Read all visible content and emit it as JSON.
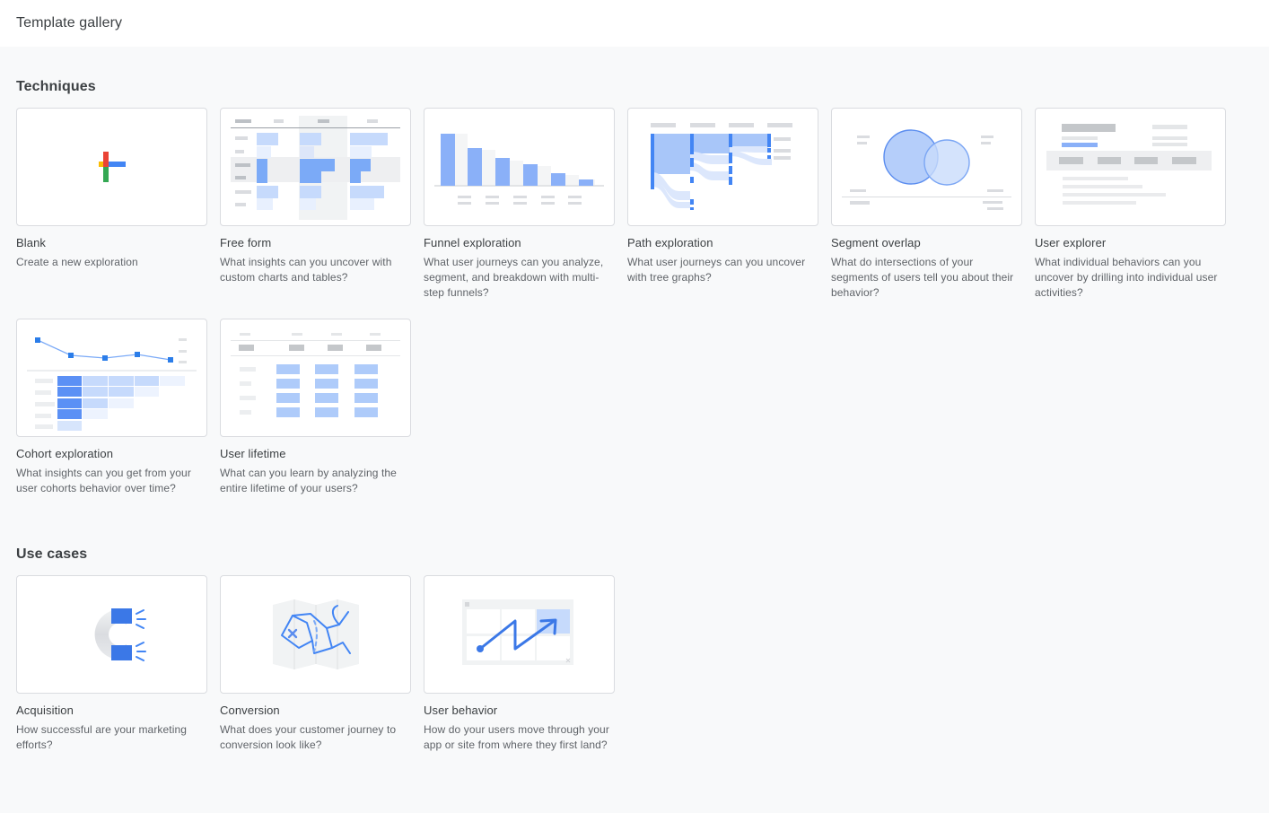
{
  "header": {
    "title": "Template gallery"
  },
  "sections": [
    {
      "id": "techniques",
      "title": "Techniques",
      "cards": [
        {
          "title": "Blank",
          "desc": "Create a new exploration",
          "thumb": "blank-plus-thumbnail"
        },
        {
          "title": "Free form",
          "desc": "What insights can you uncover with custom charts and tables?",
          "thumb": "free-form-table-thumbnail"
        },
        {
          "title": "Funnel exploration",
          "desc": "What user journeys can you analyze, segment, and breakdown with multi-step funnels?",
          "thumb": "funnel-bars-thumbnail"
        },
        {
          "title": "Path exploration",
          "desc": "What user journeys can you uncover with tree graphs?",
          "thumb": "path-sankey-thumbnail"
        },
        {
          "title": "Segment overlap",
          "desc": "What do intersections of your segments of users tell you about their behavior?",
          "thumb": "segment-venn-thumbnail"
        },
        {
          "title": "User explorer",
          "desc": "What individual behaviors can you uncover by drilling into individual user activities?",
          "thumb": "user-explorer-thumbnail"
        },
        {
          "title": "Cohort exploration",
          "desc": "What insights can you get from your user cohorts behavior over time?",
          "thumb": "cohort-line-table-thumbnail"
        },
        {
          "title": "User lifetime",
          "desc": "What can you learn by analyzing the entire lifetime of your users?",
          "thumb": "user-lifetime-table-thumbnail"
        }
      ]
    },
    {
      "id": "use-cases",
      "title": "Use cases",
      "cards": [
        {
          "title": "Acquisition",
          "desc": "How successful are your marketing efforts?",
          "thumb": "magnet-thumbnail"
        },
        {
          "title": "Conversion",
          "desc": "What does your customer journey to conversion look like?",
          "thumb": "map-thumbnail"
        },
        {
          "title": "User behavior",
          "desc": "How do your users move through your app or site from where they first land?",
          "thumb": "grid-arrow-thumbnail"
        }
      ]
    }
  ],
  "colors": {
    "page_background": "#f8f9fa",
    "header_background": "#ffffff",
    "card_border": "#dadce0",
    "title_text": "#3c4043",
    "desc_text": "#5f6368",
    "accent_blue": "#4285f4",
    "blue_mid": "#7baaf7",
    "blue_light": "#c6dafc",
    "blue_pale": "#e8f0fe",
    "grey_placeholder": "#e8eaed",
    "grey_dark_placeholder": "#bdc1c6",
    "google_red": "#ea4335",
    "google_yellow": "#fbbc04",
    "google_green": "#34a853",
    "google_blue": "#4285f4"
  }
}
